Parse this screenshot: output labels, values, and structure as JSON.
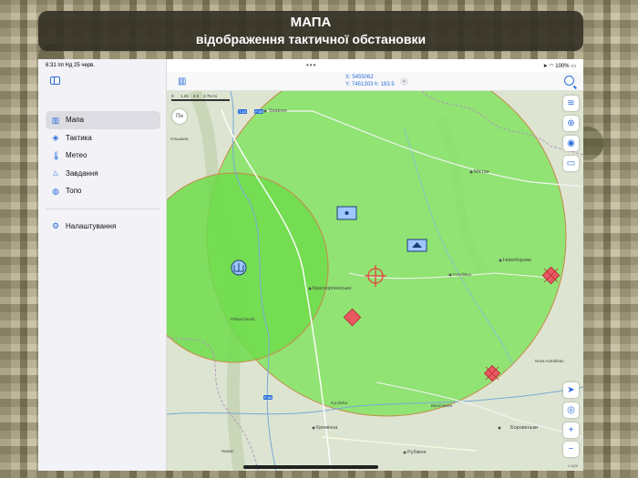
{
  "banner": {
    "title": "МАПА",
    "subtitle": "відображення тактичної обстановки"
  },
  "statusbar": {
    "time": "6:31 пп  Нд 25 черв.",
    "battery": "100%"
  },
  "sidebar": {
    "items": [
      {
        "label": "Мапа",
        "icon": "map-icon",
        "active": true
      },
      {
        "label": "Тактика",
        "icon": "layers-icon",
        "active": false
      },
      {
        "label": "Метео",
        "icon": "thermometer-icon",
        "active": false
      },
      {
        "label": "Завдання",
        "icon": "flame-icon",
        "active": false
      },
      {
        "label": "Топо",
        "icon": "globe-icon",
        "active": false
      }
    ],
    "settings_label": "Налаштування"
  },
  "map_header": {
    "coord_x": "X: 5455062",
    "coord_y": "Y: 7451303 h: 163.5"
  },
  "map": {
    "compass_label": "Пн",
    "scale_labels": [
      "0",
      "1.25",
      "2.5",
      "3.75 mi"
    ],
    "places": [
      "Svatove",
      "Містки",
      "Новоборове",
      "Голубівка",
      "Красноріченське",
      "Nova Astrakhan",
      "Кремінна",
      "Боровеньки",
      "Рубіжне",
      "Нижнє",
      "Kyrylivka",
      "Barvinkivka",
      "Ольшана",
      "Pidkuichansk"
    ],
    "roads": [
      "T-13",
      "P-66",
      "P-66"
    ],
    "attribution": "Legal",
    "colors": {
      "zone_fill": "#7be35a",
      "zone_border": "#c8874a",
      "hostile": "#e8413c",
      "friendly": "#9ec7ff"
    }
  }
}
